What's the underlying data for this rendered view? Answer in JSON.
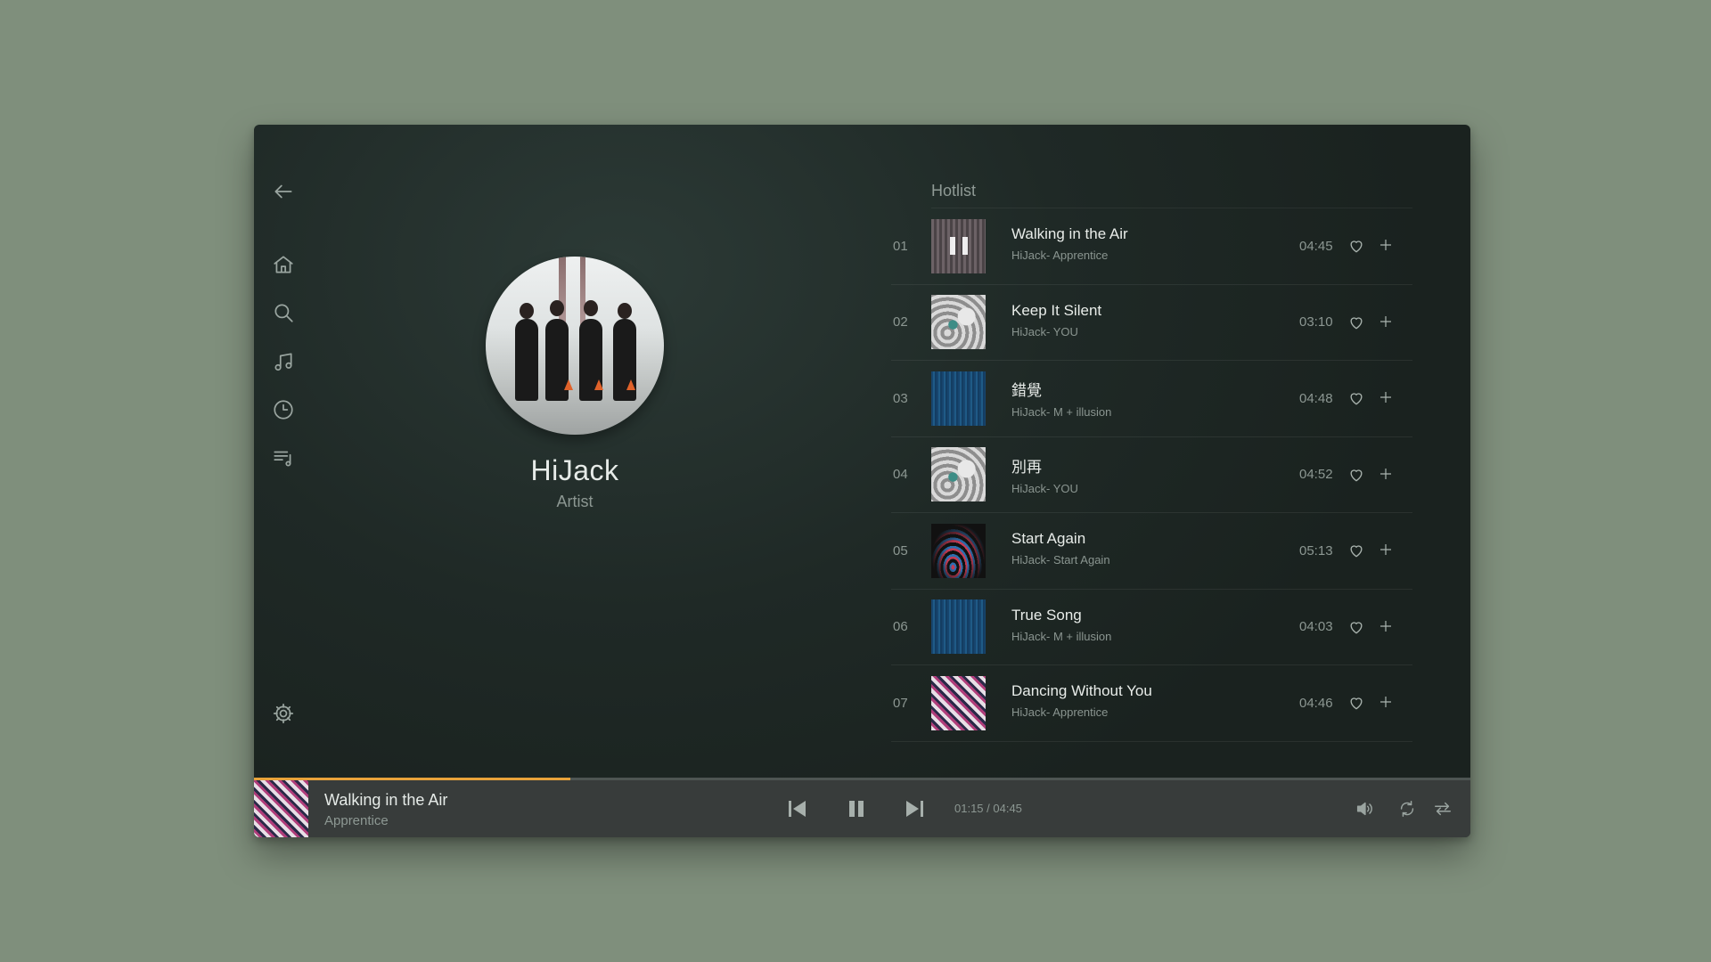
{
  "sidebar": {
    "icons": [
      "back-arrow-icon",
      "home-icon",
      "search-icon",
      "music-note-icon",
      "clock-icon",
      "playlist-icon",
      "settings-gear-icon"
    ]
  },
  "artist": {
    "name": "HiJack",
    "role": "Artist"
  },
  "hotlist": {
    "title": "Hotlist",
    "tracks": [
      {
        "num": "01",
        "title": "Walking in the Air",
        "sub": "HiJack- Apprentice",
        "duration": "04:45"
      },
      {
        "num": "02",
        "title": "Keep It Silent",
        "sub": "HiJack- YOU",
        "duration": "03:10"
      },
      {
        "num": "03",
        "title": "錯覺",
        "sub": "HiJack- M + illusion",
        "duration": "04:48"
      },
      {
        "num": "04",
        "title": "別再",
        "sub": "HiJack- YOU",
        "duration": "04:52"
      },
      {
        "num": "05",
        "title": "Start Again",
        "sub": "HiJack- Start Again",
        "duration": "05:13"
      },
      {
        "num": "06",
        "title": "True Song",
        "sub": "HiJack- M + illusion",
        "duration": "04:03"
      },
      {
        "num": "07",
        "title": "Dancing Without You",
        "sub": "HiJack- Apprentice",
        "duration": "04:46"
      }
    ]
  },
  "player": {
    "title": "Walking in the Air",
    "album": "Apprentice",
    "time": "01:15 / 04:45",
    "progress": 0.26,
    "accent": "#e9a33a"
  }
}
